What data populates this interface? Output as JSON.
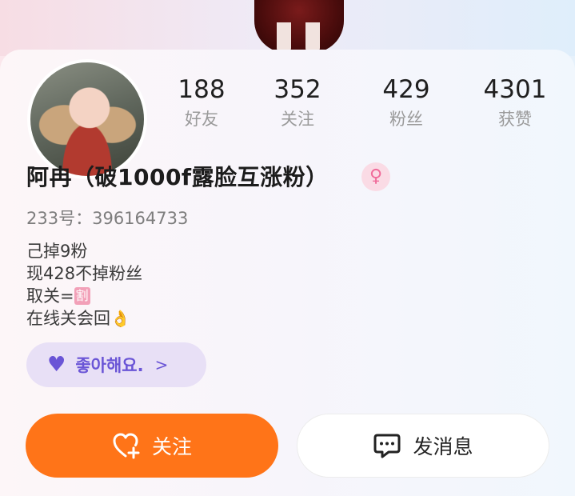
{
  "profile": {
    "name": "阿冉（破1000f露脸互涨粉）",
    "gender_icon": "female-symbol-icon",
    "uid_label": "233号：",
    "uid": "396164733"
  },
  "stats": [
    {
      "value": "188",
      "label": "好友"
    },
    {
      "value": "352",
      "label": "关注"
    },
    {
      "value": "429",
      "label": "粉丝"
    },
    {
      "value": "4301",
      "label": "获赞"
    }
  ],
  "bio": {
    "line1": "己掉9粉",
    "line2": "现428不掉粉丝",
    "line3_prefix": "取关=",
    "line3_emoji": "割",
    "line4_text": "在线关会回",
    "line4_emoji": "👌"
  },
  "tag": {
    "text": "좋아해요.",
    "icon": "purple-heart-icon"
  },
  "buttons": {
    "follow_label": "关注",
    "message_label": "发消息"
  },
  "colors": {
    "follow_button": "#ff7418",
    "tag_accent": "#6a55d6",
    "tag_bg": "#e8e0f6",
    "gender_icon": "#f06b9a"
  }
}
